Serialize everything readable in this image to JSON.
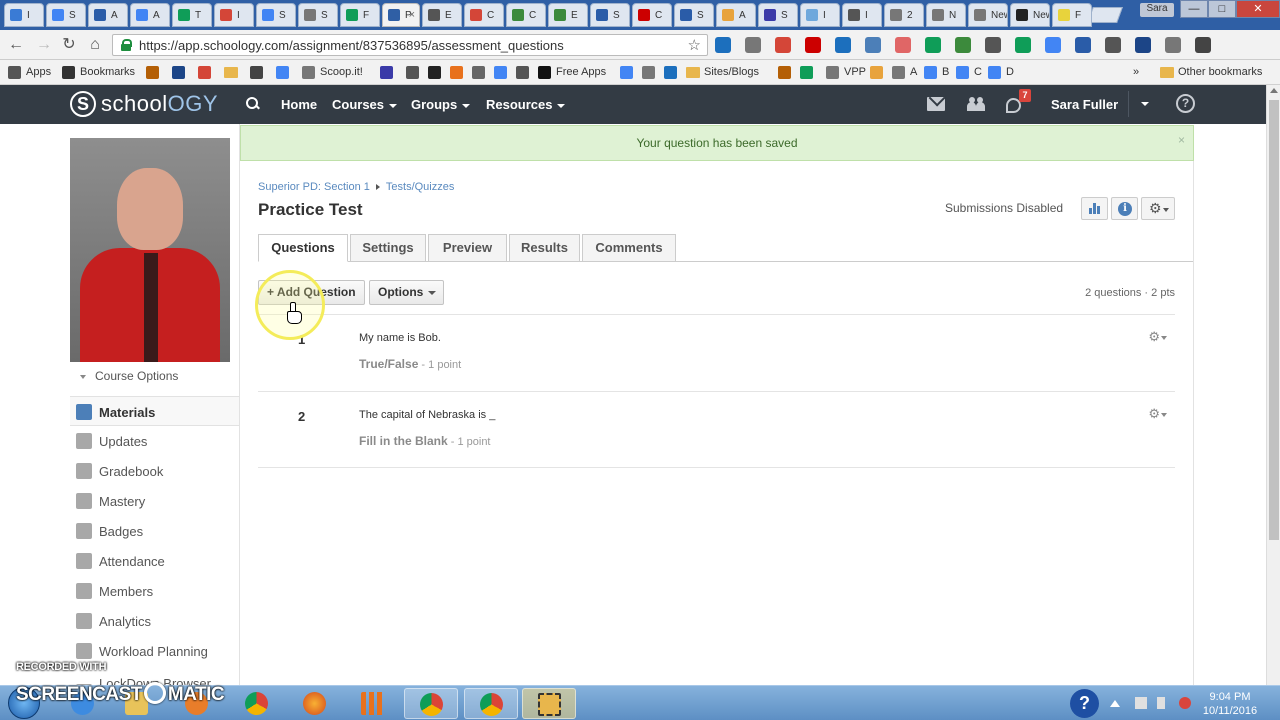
{
  "browser": {
    "tabs": [
      {
        "label": "I",
        "color": "#3a7bd5"
      },
      {
        "label": "S",
        "color": "#4285f4"
      },
      {
        "label": "A",
        "color": "#2a5ca8"
      },
      {
        "label": "A",
        "color": "#4285f4"
      },
      {
        "label": "T",
        "color": "#0f9d58"
      },
      {
        "label": "I",
        "color": "#d44638"
      },
      {
        "label": "S",
        "color": "#4285f4"
      },
      {
        "label": "S",
        "color": "#777777"
      },
      {
        "label": "F",
        "color": "#0f9d58"
      },
      {
        "label": "P",
        "color": "#2f5fa5",
        "active": true
      },
      {
        "label": "E",
        "color": "#555555"
      },
      {
        "label": "C",
        "color": "#d44638"
      },
      {
        "label": "C",
        "color": "#3c8a3c"
      },
      {
        "label": "E",
        "color": "#3c8a3c"
      },
      {
        "label": "S",
        "color": "#2a5ca8"
      },
      {
        "label": "C",
        "color": "#cc0000"
      },
      {
        "label": "S",
        "color": "#2a5ca8"
      },
      {
        "label": "A",
        "color": "#e8a33c"
      },
      {
        "label": "S",
        "color": "#3a3aa8"
      },
      {
        "label": "I",
        "color": "#6fa8dc"
      },
      {
        "label": "I",
        "color": "#555555"
      },
      {
        "label": "2",
        "color": "#777777"
      },
      {
        "label": "N",
        "color": "#777777"
      },
      {
        "label": "New",
        "color": "#777777"
      },
      {
        "label": "New",
        "color": "#222222"
      },
      {
        "label": "F",
        "color": "#e8d33c"
      }
    ],
    "user_badge": "Sara",
    "window_controls": {
      "minimize": "—",
      "maximize": "□",
      "close": "✕"
    },
    "url": "https://app.schoology.com/assignment/837536895/assessment_questions",
    "bookmarks": [
      {
        "label": "Apps",
        "icon": "apps-grid-icon",
        "color": "#555555"
      },
      {
        "label": "Bookmarks",
        "icon": "star-icon",
        "color": "#333333"
      },
      {
        "label": "",
        "color": "#b45f06"
      },
      {
        "label": "",
        "color": "#1c4587"
      },
      {
        "label": "",
        "color": "#d44638"
      },
      {
        "label": "",
        "folder": true
      },
      {
        "label": "",
        "color": "#444444"
      },
      {
        "label": "",
        "color": "#4285f4"
      },
      {
        "label": "Scoop.it!",
        "color": "#777777"
      },
      {
        "label": "",
        "color": "#3a3aa8"
      },
      {
        "label": "",
        "color": "#555555"
      },
      {
        "label": "",
        "color": "#222222"
      },
      {
        "label": "",
        "color": "#e8711c"
      },
      {
        "label": "",
        "color": "#666666"
      },
      {
        "label": "",
        "color": "#4285f4"
      },
      {
        "label": "",
        "color": "#555555"
      },
      {
        "label": "Free Apps",
        "color": "#111111"
      },
      {
        "label": "",
        "color": "#4285f4"
      },
      {
        "label": "",
        "color": "#777777"
      },
      {
        "label": "",
        "color": "#1c6fbd"
      },
      {
        "label": "Sites/Blogs",
        "folder": true
      },
      {
        "label": "",
        "color": "#b45f06"
      },
      {
        "label": "",
        "color": "#0f9d58"
      },
      {
        "label": "VPP",
        "color": "#777777"
      },
      {
        "label": "",
        "color": "#e8a33c"
      },
      {
        "label": "A",
        "color": "#777777"
      },
      {
        "label": "B",
        "color": "#4285f4"
      },
      {
        "label": "C",
        "color": "#4285f4"
      },
      {
        "label": "D",
        "color": "#4285f4"
      }
    ],
    "bookmarks_overflow": "»",
    "other_bookmarks": "Other bookmarks"
  },
  "header": {
    "logo_prefix": "school",
    "logo_suffix": "OGY",
    "nav": [
      {
        "label": "Home",
        "dropdown": false
      },
      {
        "label": "Courses",
        "dropdown": true
      },
      {
        "label": "Groups",
        "dropdown": true
      },
      {
        "label": "Resources",
        "dropdown": true
      }
    ],
    "notification_count": "7",
    "user_name": "Sara Fuller",
    "help": "?"
  },
  "sidebar": {
    "course_options": "Course Options",
    "items": [
      {
        "label": "Materials",
        "name": "materials",
        "active": true
      },
      {
        "label": "Updates",
        "name": "updates"
      },
      {
        "label": "Gradebook",
        "name": "gradebook"
      },
      {
        "label": "Mastery",
        "name": "mastery"
      },
      {
        "label": "Badges",
        "name": "badges"
      },
      {
        "label": "Attendance",
        "name": "attendance"
      },
      {
        "label": "Members",
        "name": "members"
      },
      {
        "label": "Analytics",
        "name": "analytics"
      },
      {
        "label": "Workload Planning",
        "name": "workload-planning"
      },
      {
        "label": "LockDown Browser",
        "name": "lockdown-browser"
      }
    ]
  },
  "main": {
    "success_message": "Your question has been saved",
    "close": "×",
    "breadcrumb": {
      "section": "Superior PD: Section 1",
      "current": "Tests/Quizzes"
    },
    "title": "Practice Test",
    "submissions_status": "Submissions Disabled",
    "tabs": [
      {
        "label": "Questions",
        "active": true
      },
      {
        "label": "Settings"
      },
      {
        "label": "Preview"
      },
      {
        "label": "Results"
      },
      {
        "label": "Comments"
      }
    ],
    "add_question": "+ Add Question",
    "options": "Options",
    "question_count": "2 questions · 2 pts",
    "questions": [
      {
        "number": "1",
        "text": "My name is Bob.",
        "type": "True/False",
        "points": " - 1 point"
      },
      {
        "number": "2",
        "text": "The capital of Nebraska is _",
        "type": "Fill in the Blank",
        "points": " - 1 point"
      }
    ]
  },
  "watermark": {
    "line1": "RECORDED WITH",
    "prefix": "SCREENCAST",
    "suffix": "MATIC"
  },
  "taskbar": {
    "help": "?",
    "time": "9:04 PM",
    "date": "10/11/2016"
  }
}
